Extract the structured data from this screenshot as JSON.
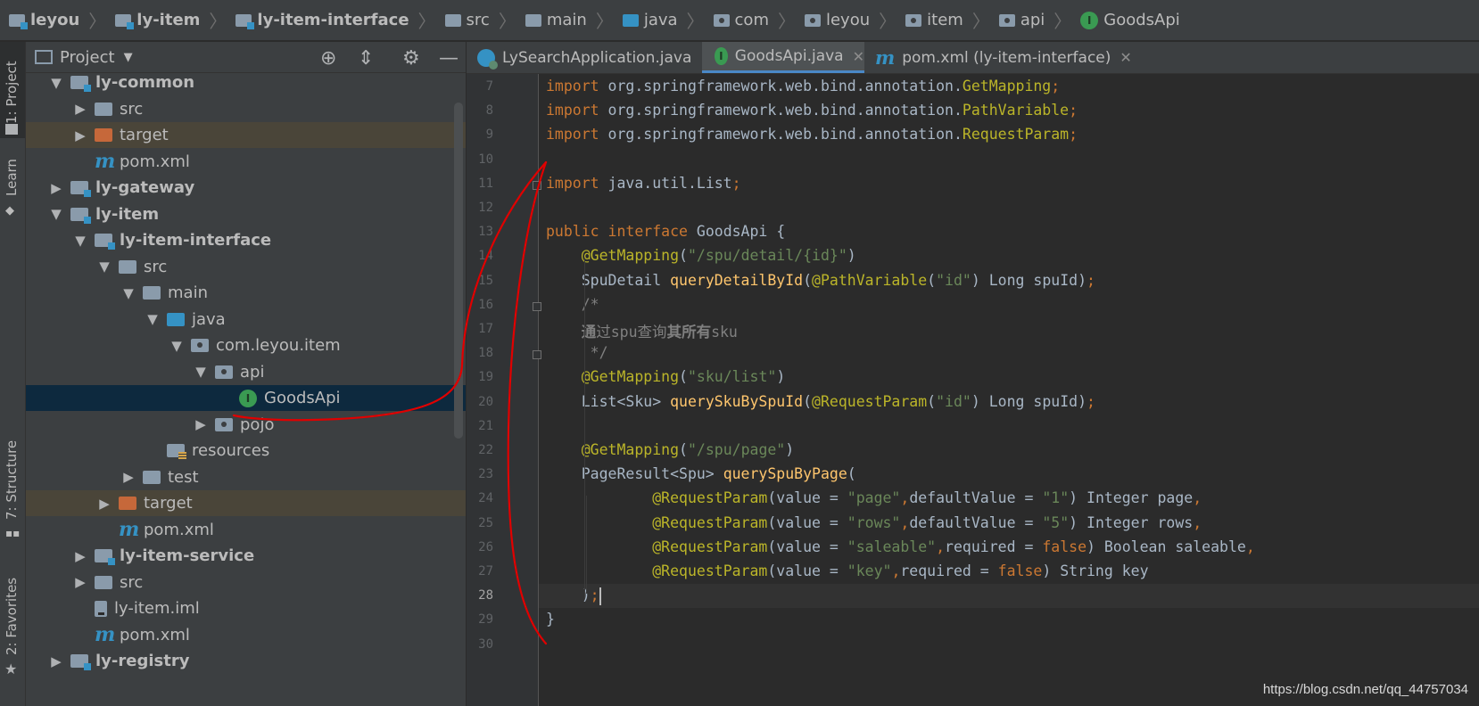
{
  "breadcrumb": [
    "leyou",
    "ly-item",
    "ly-item-interface",
    "src",
    "main",
    "java",
    "com",
    "leyou",
    "item",
    "api",
    "GoodsApi"
  ],
  "toolstripe": {
    "project": "1: Project",
    "learn": "Learn",
    "structure": "7: Structure",
    "favorites": "2: Favorites"
  },
  "project_panel": {
    "title": "Project",
    "tree": [
      {
        "label": "ly-common",
        "arrow": "▼",
        "icon": "module",
        "bold": true
      },
      {
        "label": "src",
        "arrow": "▶",
        "icon": "folder"
      },
      {
        "label": "target",
        "arrow": "▶",
        "icon": "folder-excluded"
      },
      {
        "label": "pom.xml",
        "arrow": "",
        "icon": "maven"
      },
      {
        "label": "ly-gateway",
        "arrow": "▶",
        "icon": "module",
        "bold": true
      },
      {
        "label": "ly-item",
        "arrow": "▼",
        "icon": "module",
        "bold": true
      },
      {
        "label": "ly-item-interface",
        "arrow": "▼",
        "icon": "module",
        "bold": true
      },
      {
        "label": "src",
        "arrow": "▼",
        "icon": "folder"
      },
      {
        "label": "main",
        "arrow": "▼",
        "icon": "folder"
      },
      {
        "label": "java",
        "arrow": "▼",
        "icon": "folder-source"
      },
      {
        "label": "com.leyou.item",
        "arrow": "▼",
        "icon": "package"
      },
      {
        "label": "api",
        "arrow": "▼",
        "icon": "package"
      },
      {
        "label": "GoodsApi",
        "arrow": "",
        "icon": "interface"
      },
      {
        "label": "pojo",
        "arrow": "▶",
        "icon": "package"
      },
      {
        "label": "resources",
        "arrow": "",
        "icon": "folder-resources"
      },
      {
        "label": "test",
        "arrow": "▶",
        "icon": "folder"
      },
      {
        "label": "target",
        "arrow": "▶",
        "icon": "folder-excluded"
      },
      {
        "label": "pom.xml",
        "arrow": "",
        "icon": "maven"
      },
      {
        "label": "ly-item-service",
        "arrow": "▶",
        "icon": "module",
        "bold": true
      },
      {
        "label": "src",
        "arrow": "▶",
        "icon": "folder"
      },
      {
        "label": "ly-item.iml",
        "arrow": "",
        "icon": "iml"
      },
      {
        "label": "pom.xml",
        "arrow": "",
        "icon": "maven"
      },
      {
        "label": "ly-registry",
        "arrow": "▶",
        "icon": "module",
        "bold": true
      }
    ]
  },
  "editor": {
    "tabs": [
      {
        "label": "LySearchApplication.java",
        "icon": "class-icon"
      },
      {
        "label": "GoodsApi.java",
        "icon": "interface-icon",
        "active": true
      },
      {
        "label": "pom.xml (ly-item-interface)",
        "icon": "maven-icon"
      }
    ],
    "current_line": 28,
    "lines": [
      {
        "n": "7",
        "segs": [
          [
            "k",
            "import "
          ],
          [
            "p",
            "org.springframework.web.bind.annotation."
          ],
          [
            "a",
            "GetMapping"
          ],
          [
            "k",
            ";"
          ]
        ]
      },
      {
        "n": "8",
        "segs": [
          [
            "k",
            "import "
          ],
          [
            "p",
            "org.springframework.web.bind.annotation."
          ],
          [
            "a",
            "PathVariable"
          ],
          [
            "k",
            ";"
          ]
        ]
      },
      {
        "n": "9",
        "segs": [
          [
            "k",
            "import "
          ],
          [
            "p",
            "org.springframework.web.bind.annotation."
          ],
          [
            "a",
            "RequestParam"
          ],
          [
            "k",
            ";"
          ]
        ]
      },
      {
        "n": "10",
        "segs": []
      },
      {
        "n": "11",
        "segs": [
          [
            "k",
            "import "
          ],
          [
            "p",
            "java.util.List"
          ],
          [
            "k",
            ";"
          ]
        ]
      },
      {
        "n": "12",
        "segs": []
      },
      {
        "n": "13",
        "segs": [
          [
            "k",
            "public interface "
          ],
          [
            "p",
            "GoodsApi {"
          ]
        ]
      },
      {
        "n": "14",
        "segs": [
          [
            "p",
            "    "
          ],
          [
            "a",
            "@GetMapping"
          ],
          [
            "p",
            "("
          ],
          [
            "s",
            "\"/spu/detail/{id}\""
          ],
          [
            "p",
            ")"
          ]
        ]
      },
      {
        "n": "15",
        "segs": [
          [
            "p",
            "    SpuDetail "
          ],
          [
            "f",
            "queryDetailById"
          ],
          [
            "p",
            "("
          ],
          [
            "a",
            "@PathVariable"
          ],
          [
            "p",
            "("
          ],
          [
            "s",
            "\"id\""
          ],
          [
            "p",
            ") Long spuId)"
          ],
          [
            "k",
            ";"
          ]
        ]
      },
      {
        "n": "16",
        "segs": [
          [
            "c",
            "    /*"
          ]
        ]
      },
      {
        "n": "17",
        "segs": [
          [
            "p",
            "    "
          ],
          [
            "cb",
            "通"
          ],
          [
            "c",
            "过spu查询"
          ],
          [
            "cb",
            "其所有"
          ],
          [
            "c",
            "sku"
          ]
        ]
      },
      {
        "n": "18",
        "segs": [
          [
            "c",
            "     */"
          ]
        ]
      },
      {
        "n": "19",
        "segs": [
          [
            "p",
            "    "
          ],
          [
            "a",
            "@GetMapping"
          ],
          [
            "p",
            "("
          ],
          [
            "s",
            "\"sku/list\""
          ],
          [
            "p",
            ")"
          ]
        ]
      },
      {
        "n": "20",
        "segs": [
          [
            "p",
            "    List<Sku> "
          ],
          [
            "f",
            "querySkuBySpuId"
          ],
          [
            "p",
            "("
          ],
          [
            "a",
            "@RequestParam"
          ],
          [
            "p",
            "("
          ],
          [
            "s",
            "\"id\""
          ],
          [
            "p",
            ") Long spuId)"
          ],
          [
            "k",
            ";"
          ]
        ]
      },
      {
        "n": "21",
        "segs": []
      },
      {
        "n": "22",
        "segs": [
          [
            "p",
            "    "
          ],
          [
            "a",
            "@GetMapping"
          ],
          [
            "p",
            "("
          ],
          [
            "s",
            "\"/spu/page\""
          ],
          [
            "p",
            ")"
          ]
        ]
      },
      {
        "n": "23",
        "segs": [
          [
            "p",
            "    PageResult<Spu> "
          ],
          [
            "f",
            "querySpuByPage"
          ],
          [
            "p",
            "("
          ]
        ]
      },
      {
        "n": "24",
        "segs": [
          [
            "p",
            "            "
          ],
          [
            "a",
            "@RequestParam"
          ],
          [
            "p",
            "(value = "
          ],
          [
            "s",
            "\"page\""
          ],
          [
            "k",
            ","
          ],
          [
            "p",
            "defaultValue = "
          ],
          [
            "s",
            "\"1\""
          ],
          [
            "p",
            ") Integer page"
          ],
          [
            "k",
            ","
          ]
        ]
      },
      {
        "n": "25",
        "segs": [
          [
            "p",
            "            "
          ],
          [
            "a",
            "@RequestParam"
          ],
          [
            "p",
            "(value = "
          ],
          [
            "s",
            "\"rows\""
          ],
          [
            "k",
            ","
          ],
          [
            "p",
            "defaultValue = "
          ],
          [
            "s",
            "\"5\""
          ],
          [
            "p",
            ") Integer rows"
          ],
          [
            "k",
            ","
          ]
        ]
      },
      {
        "n": "26",
        "segs": [
          [
            "p",
            "            "
          ],
          [
            "a",
            "@RequestParam"
          ],
          [
            "p",
            "(value = "
          ],
          [
            "s",
            "\"saleable\""
          ],
          [
            "k",
            ","
          ],
          [
            "p",
            "required = "
          ],
          [
            "k",
            "false"
          ],
          [
            "p",
            ") Boolean saleable"
          ],
          [
            "k",
            ","
          ]
        ]
      },
      {
        "n": "27",
        "segs": [
          [
            "p",
            "            "
          ],
          [
            "a",
            "@RequestParam"
          ],
          [
            "p",
            "(value = "
          ],
          [
            "s",
            "\"key\""
          ],
          [
            "k",
            ","
          ],
          [
            "p",
            "required = "
          ],
          [
            "k",
            "false"
          ],
          [
            "p",
            ") String key"
          ]
        ]
      },
      {
        "n": "28",
        "segs": [
          [
            "p",
            "    )"
          ],
          [
            "k",
            ";"
          ]
        ]
      },
      {
        "n": "29",
        "segs": [
          [
            "p",
            "}"
          ]
        ]
      },
      {
        "n": "30",
        "segs": []
      }
    ]
  },
  "watermark": "https://blog.csdn.net/qq_44757034",
  "colors": {
    "keyword": "#cc7832",
    "annotation": "#bbb529",
    "string": "#6a8759",
    "method": "#ffc66d",
    "comment": "#808080",
    "annotation_stroke": "#e00000"
  }
}
